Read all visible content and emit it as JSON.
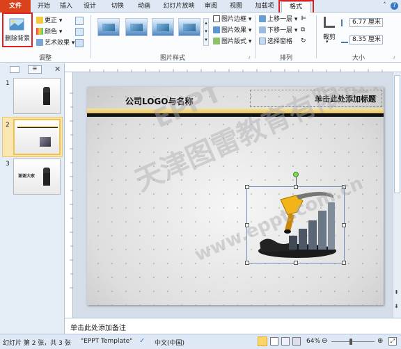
{
  "tabs": {
    "file": "文件",
    "items": [
      "开始",
      "插入",
      "设计",
      "切换",
      "动画",
      "幻灯片放映",
      "审阅",
      "视图",
      "加载项",
      "格式"
    ],
    "active": "格式"
  },
  "ribbon": {
    "adjust": {
      "remove_bg": "删除背景",
      "correct": "更正",
      "color": "颜色",
      "art_effects": "艺术效果",
      "group_label": "调整"
    },
    "picture_styles": {
      "border": "图片边框",
      "effects": "图片效果",
      "layout": "图片版式",
      "group_label": "图片样式"
    },
    "arrange": {
      "bring_forward": "上移一层",
      "send_backward": "下移一层",
      "selection_pane": "选择窗格",
      "group_label": "排列"
    },
    "size": {
      "crop": "裁剪",
      "height": "6.77 厘米",
      "width": "8.35 厘米",
      "group_label": "大小"
    }
  },
  "panel": {
    "slides": [
      {
        "num": "1"
      },
      {
        "num": "2"
      },
      {
        "num": "3",
        "caption": "谢谢大家"
      }
    ]
  },
  "slide": {
    "logo_text": "公司LOGO与名称",
    "title_placeholder": "单击此处添加标题",
    "watermark_main": "天津图雷教育有限责任公司",
    "watermark_mid": "EPPT",
    "watermark_url": "www.eppt.com.cn"
  },
  "notes": {
    "placeholder": "单击此处添加备注"
  },
  "status": {
    "slide_info": "幻灯片 第 2 张，共 3 张",
    "theme": "\"EPPT Template\"",
    "language": "中文(中国)",
    "zoom": "64%"
  },
  "colors": {
    "file_tab": "#d9421b",
    "highlight": "#e02020",
    "slide_band": "#f2d27a"
  }
}
